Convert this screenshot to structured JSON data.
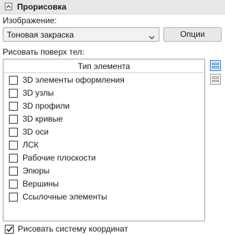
{
  "panel": {
    "title": "Прорисовка",
    "collapse_icon": "chevron-up-icon"
  },
  "image": {
    "label": "Изображение:",
    "selected": "Тоновая закраска",
    "options_button": "Опции"
  },
  "draw_over": {
    "label": "Рисовать поверх тел:",
    "column_header": "Тип элемента",
    "items": [
      {
        "label": "3D элементы оформления",
        "checked": false
      },
      {
        "label": "3D узлы",
        "checked": false
      },
      {
        "label": "3D профили",
        "checked": false
      },
      {
        "label": "3D кривые",
        "checked": false
      },
      {
        "label": "3D оси",
        "checked": false
      },
      {
        "label": "ЛСК",
        "checked": false
      },
      {
        "label": "Рабочие плоскости",
        "checked": false
      },
      {
        "label": "Эпюры",
        "checked": false
      },
      {
        "label": "Вершины",
        "checked": false
      },
      {
        "label": "Ссылочные элементы",
        "checked": false
      }
    ],
    "side_icons": [
      "select-all-icon",
      "deselect-all-icon"
    ]
  },
  "draw_coordinate_system": {
    "label": "Рисовать систему координат",
    "checked": true
  },
  "colors": {
    "accent": "#3a78c2",
    "header_bg": "#e8e8e8"
  }
}
